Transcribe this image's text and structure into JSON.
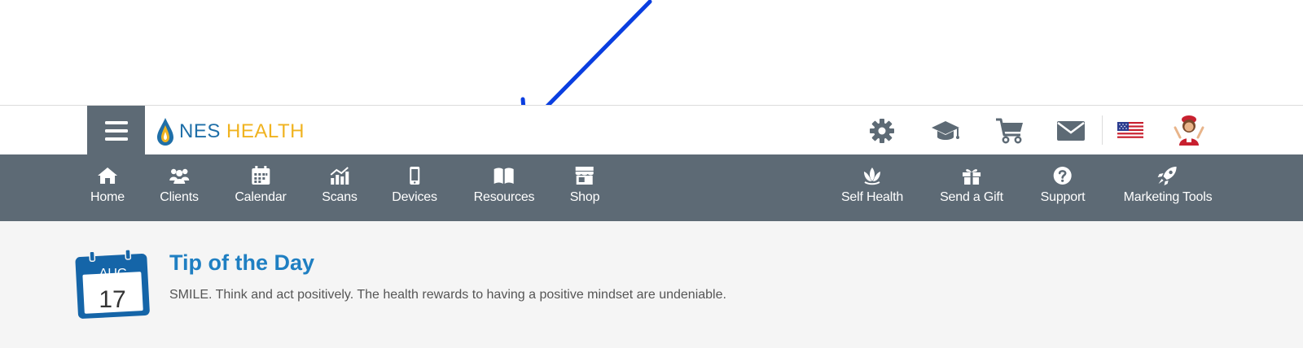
{
  "brand": {
    "name_part1": "NES",
    "name_part2": "HEALTH"
  },
  "header_icons": [
    {
      "name": "gear-icon"
    },
    {
      "name": "graduation-cap-icon"
    },
    {
      "name": "cart-icon"
    },
    {
      "name": "envelope-icon"
    },
    {
      "name": "us-flag-icon"
    },
    {
      "name": "avatar"
    }
  ],
  "nav": {
    "left": [
      {
        "label": "Home",
        "icon": "home-icon"
      },
      {
        "label": "Clients",
        "icon": "users-icon"
      },
      {
        "label": "Calendar",
        "icon": "calendar-icon"
      },
      {
        "label": "Scans",
        "icon": "chart-icon"
      },
      {
        "label": "Devices",
        "icon": "mobile-icon"
      },
      {
        "label": "Resources",
        "icon": "book-icon"
      },
      {
        "label": "Shop",
        "icon": "store-icon"
      }
    ],
    "right": [
      {
        "label": "Self Health",
        "icon": "lotus-icon"
      },
      {
        "label": "Send a Gift",
        "icon": "gift-icon"
      },
      {
        "label": "Support",
        "icon": "question-icon"
      },
      {
        "label": "Marketing Tools",
        "icon": "rocket-icon"
      }
    ]
  },
  "tip": {
    "month": "AUG",
    "day": "17",
    "title": "Tip of the Day",
    "text": "SMILE. Think and act positively. The health rewards to having a positive mindset are undeniable."
  },
  "colors": {
    "nav_bg": "#5d6a75",
    "accent_blue": "#1f7fc2",
    "annotation": "#0a3ee0",
    "brand_gold": "#f0b320"
  }
}
